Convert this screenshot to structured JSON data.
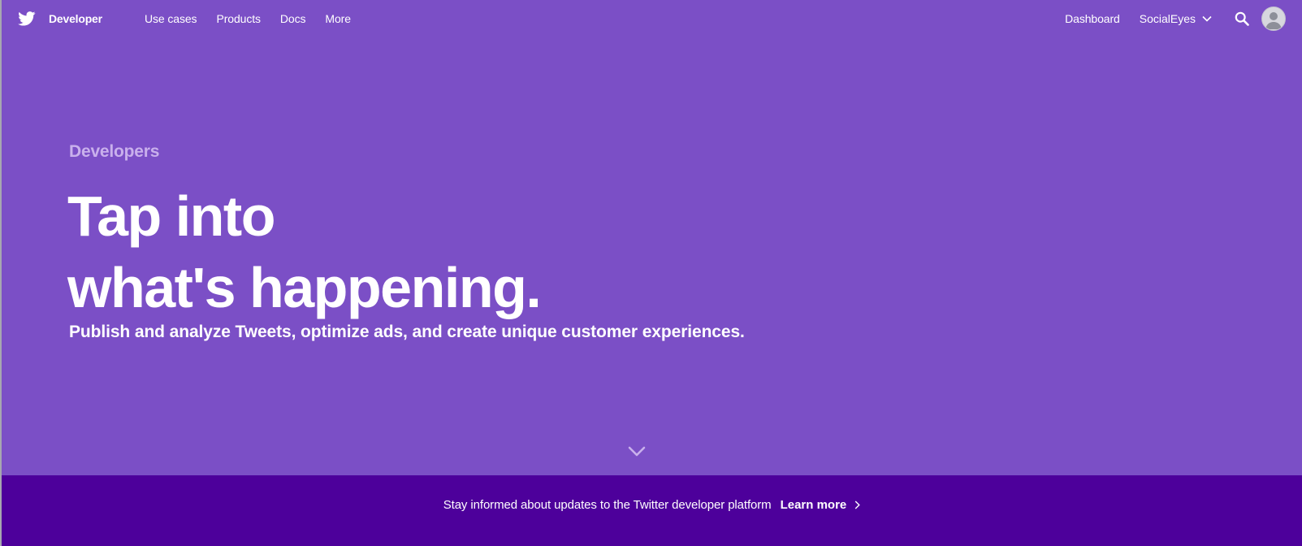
{
  "nav": {
    "brand_label": "Developer",
    "links": [
      "Use cases",
      "Products",
      "Docs",
      "More"
    ],
    "dashboard_label": "Dashboard",
    "account_label": "SocialEyes"
  },
  "hero": {
    "eyebrow": "Developers",
    "headline_line1": "Tap into",
    "headline_line2": "what's happening.",
    "subhead": "Publish and analyze Tweets, optimize ads, and create unique customer experiences."
  },
  "banner": {
    "text": "Stay informed about updates to the Twitter developer platform",
    "link_label": "Learn more"
  },
  "icons": {
    "logo": "twitter-bird-icon",
    "account_toggle": "chevron-down-icon",
    "search": "search-icon",
    "avatar": "user-avatar-icon",
    "scroll": "chevron-down-icon",
    "learn_more": "chevron-right-icon"
  },
  "colors": {
    "hero_background": "#7b4fc6",
    "banner_background": "#4d009b",
    "eyebrow_text": "#c9b0ec",
    "text": "#ffffff"
  }
}
